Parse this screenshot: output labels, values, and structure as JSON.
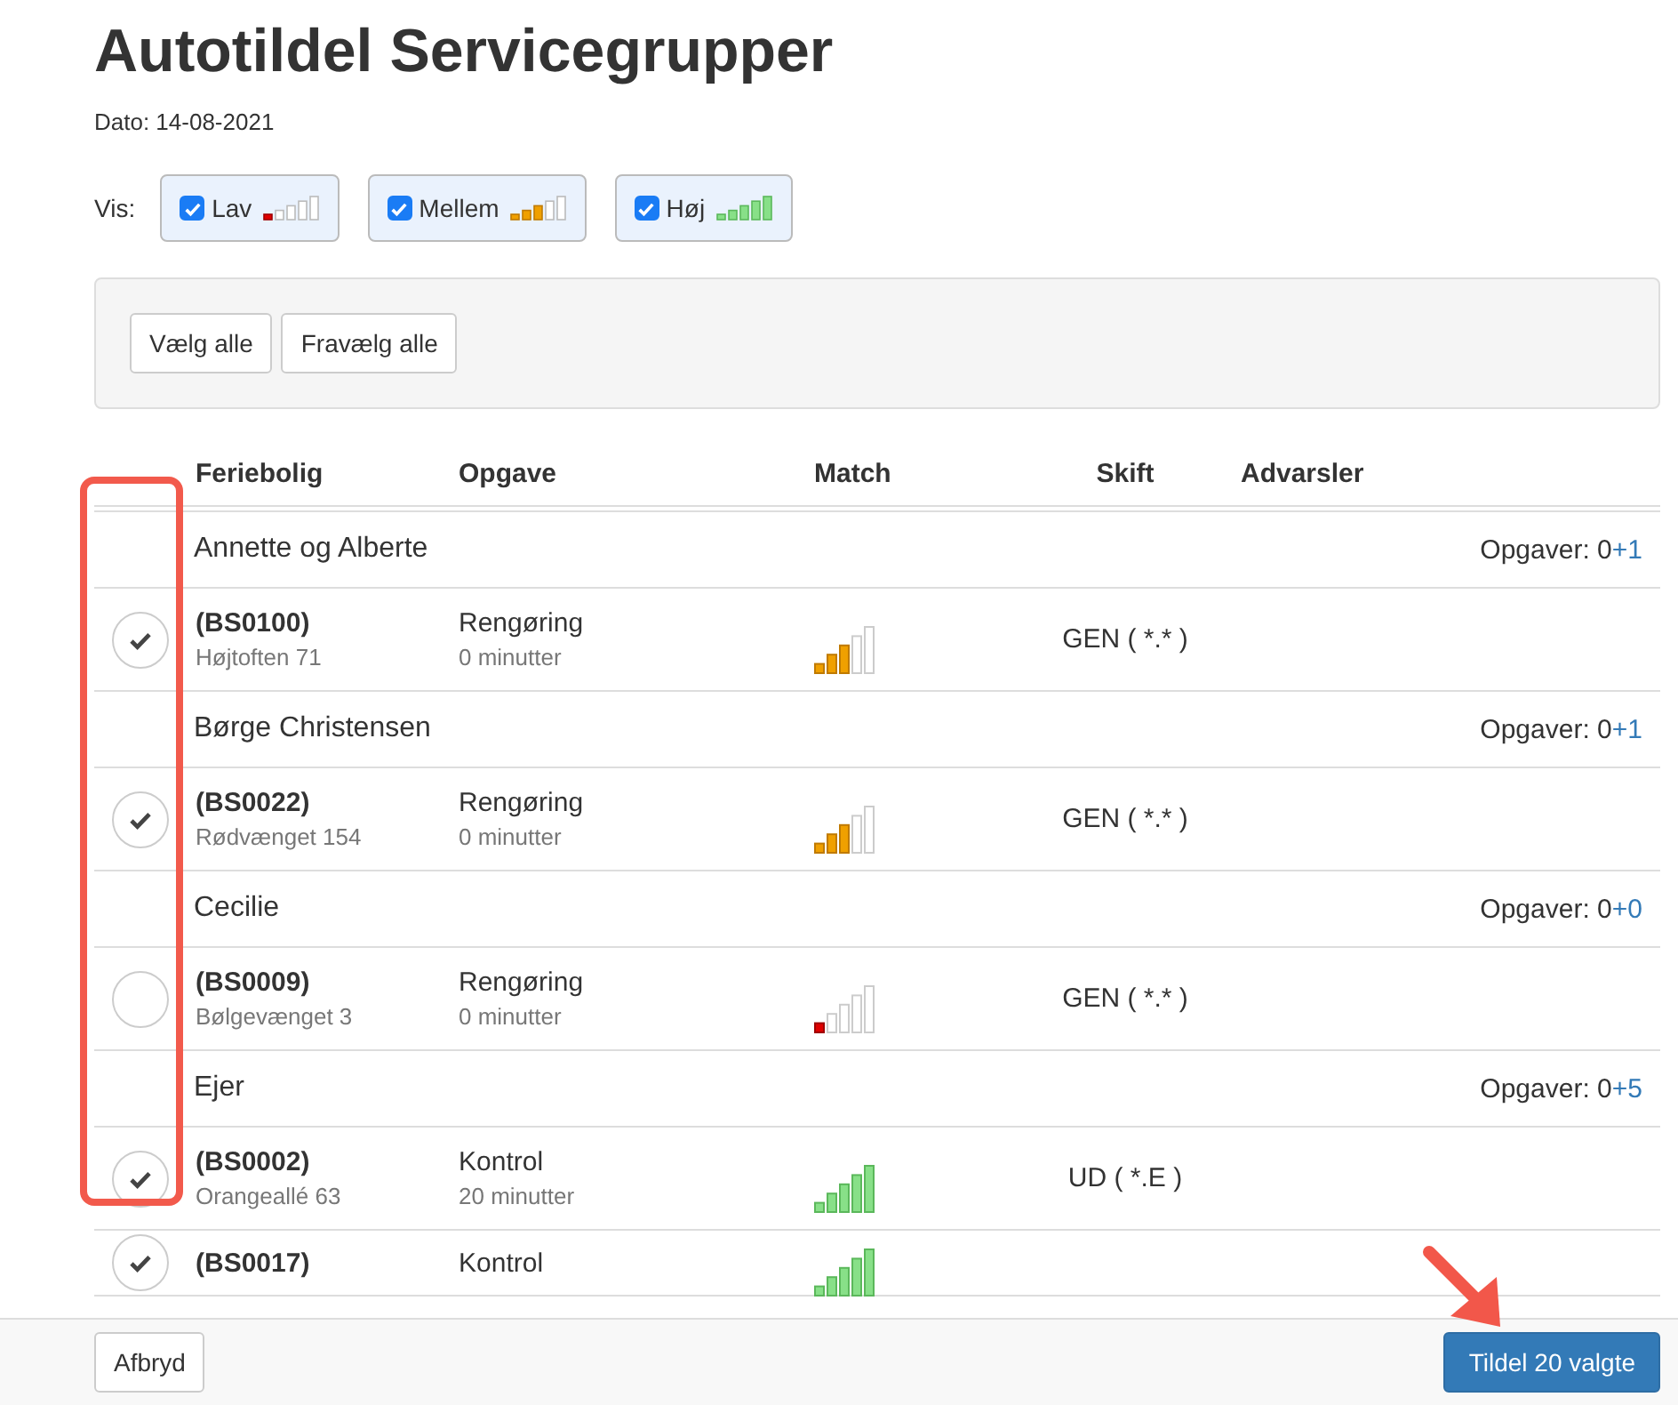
{
  "title": "Autotildel Servicegrupper",
  "date": "Dato: 14-08-2021",
  "filter": {
    "label": "Vis:",
    "options": [
      {
        "label": "Lav",
        "checked": true,
        "level": 0.2
      },
      {
        "label": "Mellem",
        "checked": true,
        "level": 0.6
      },
      {
        "label": "Høj",
        "checked": true,
        "level": 1.0
      }
    ]
  },
  "toolbar": {
    "buttons": [
      "Vælg alle",
      "Fravælg alle"
    ]
  },
  "table": {
    "columns": [
      "Feriebolig",
      "Opgave",
      "Match",
      "Skift",
      "Advarsler"
    ],
    "groups": [
      {
        "name": "Annette og Alberte",
        "tasks_label": "Opgaver: 0",
        "tasks_added": "+1",
        "rows": [
          {
            "selected": true,
            "id": "(BS0100)",
            "address": "Højtoften 71",
            "task": "Rengøring",
            "duration": "0 minutter",
            "level": 0.6,
            "shift": "GEN ( *.* )"
          }
        ]
      },
      {
        "name": "Børge Christensen",
        "tasks_label": "Opgaver: 0",
        "tasks_added": "+1",
        "rows": [
          {
            "selected": true,
            "id": "(BS0022)",
            "address": "Rødvænget 154",
            "task": "Rengøring",
            "duration": "0 minutter",
            "level": 0.6,
            "shift": "GEN ( *.* )"
          }
        ]
      },
      {
        "name": "Cecilie",
        "tasks_label": "Opgaver: 0",
        "tasks_added": "+0",
        "rows": [
          {
            "selected": false,
            "id": "(BS0009)",
            "address": "Bølgevænget 3",
            "task": "Rengøring",
            "duration": "0 minutter",
            "level": 0.2,
            "shift": "GEN ( *.* )"
          }
        ]
      },
      {
        "name": "Ejer",
        "tasks_label": "Opgaver: 0",
        "tasks_added": "+5",
        "rows": [
          {
            "selected": true,
            "id": "(BS0002)",
            "address": "Orangeallé 63",
            "task": "Kontrol",
            "duration": "20 minutter",
            "level": 1.0,
            "shift": "UD ( *.E )"
          },
          {
            "selected": true,
            "id": "(BS0017)",
            "task": "Kontrol",
            "level": 1.0
          }
        ]
      }
    ]
  },
  "footer": {
    "cancel": "Afbryd",
    "submit": "Tildel 20 valgte"
  },
  "annotations": {
    "highlight_frame": true,
    "arrow": true
  }
}
